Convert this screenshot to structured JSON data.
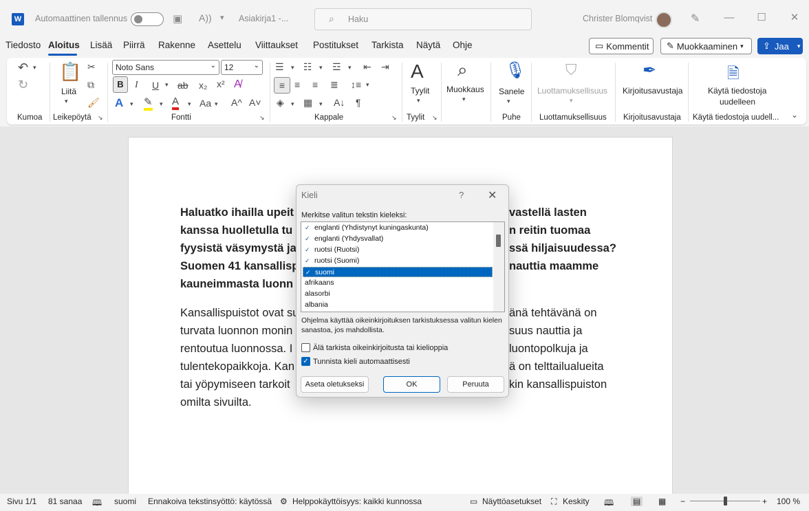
{
  "titlebar": {
    "app_icon": "W",
    "autosave_label": "Automaattinen tallennus",
    "doc_name": "Asiakirja1 -...",
    "search_placeholder": "Haku",
    "user_name": "Christer Blomqvist"
  },
  "menu": {
    "tabs": [
      "Tiedosto",
      "Aloitus",
      "Lisää",
      "Piirrä",
      "Rakenne",
      "Asettelu",
      "Viittaukset",
      "Postitukset",
      "Tarkista",
      "Näytä",
      "Ohje"
    ],
    "comments_label": "Kommentit",
    "editing_label": "Muokkaaminen",
    "share_label": "Jaa"
  },
  "ribbon": {
    "groups": {
      "undo": "Kumoa",
      "clipboard": "Leikepöytä",
      "font": "Fontti",
      "paragraph": "Kappale",
      "styles": "Tyylit",
      "voice": "Puhe",
      "sensitivity": "Luottamuksellisuus",
      "editor": "Kirjoitusavustaja",
      "reuse": "Käytä tiedostoja uudell..."
    },
    "paste_label": "Liitä",
    "font_name": "Noto Sans",
    "font_size": "12",
    "styles_label": "Tyylit",
    "find_label": "Muokkaus",
    "dictate_label": "Sanele",
    "sensitivity_label": "Luottamuksellisuus",
    "editor_label": "Kirjoitusavustaja",
    "reuse_label_1": "Käytä tiedostoja",
    "reuse_label_2": "uudelleen",
    "format_labels": {
      "bold": "B",
      "italic": "I",
      "underline": "U",
      "strike": "ab",
      "subscript": "x₂",
      "superscript": "x²",
      "case": "Aa",
      "grow": "A^",
      "shrink": "A˅",
      "pilcrow": "¶"
    }
  },
  "document": {
    "p1_lines": [
      "Haluatko ihailla upeit",
      "kanssa huolletulla tu",
      "fyysistä väsymystä ja",
      "Suomen 41 kansallisp",
      "kauneimmasta luonn"
    ],
    "p1_right": [
      "vastellä lasten",
      "n reitin tuomaa",
      "ssä hiljaisuudessa?",
      "nauttia maamme",
      ""
    ],
    "p2_lines": [
      "Kansallispuistot ovat su",
      "turvata luonnon monin",
      "rentoutua luonnossa. I",
      "tulentekopaikkoja. Kan",
      "tai yöpymiseen tarkoit",
      "omilta sivuilta."
    ],
    "p2_right": [
      "änä tehtävänä on",
      "suus nauttia ja",
      "luontopolkuja ja",
      "ä on telttailualueita",
      "kin kansallispuiston",
      ""
    ]
  },
  "dialog": {
    "title": "Kieli",
    "help": "?",
    "close": "✕",
    "prompt": "Merkitse valitun tekstin kieleksi:",
    "languages": [
      {
        "name": "englanti (Yhdistynyt kuningaskunta)",
        "checked": true,
        "selected": false
      },
      {
        "name": "englanti (Yhdysvallat)",
        "checked": true,
        "selected": false
      },
      {
        "name": "ruotsi (Ruotsi)",
        "checked": true,
        "selected": false
      },
      {
        "name": "ruotsi (Suomi)",
        "checked": true,
        "selected": false
      },
      {
        "name": "suomi",
        "checked": true,
        "selected": true
      },
      {
        "name": "afrikaans",
        "checked": false,
        "selected": false
      },
      {
        "name": "alasorbi",
        "checked": false,
        "selected": false
      },
      {
        "name": "albania",
        "checked": false,
        "selected": false
      }
    ],
    "info": "Ohjelma käyttää oikeinkirjoituksen tarkistuksessa valitun kielen sanastoa, jos mahdollista.",
    "no_proof_label": "Älä tarkista oikeinkirjoitusta tai kielioppia",
    "no_proof_checked": false,
    "detect_label": "Tunnista kieli automaattisesti",
    "detect_checked": true,
    "default_button": "Aseta oletukseksi",
    "ok_button": "OK",
    "cancel_button": "Peruuta"
  },
  "status": {
    "page": "Sivu 1/1",
    "words": "81 sanaa",
    "language": "suomi",
    "predictive": "Ennakoiva tekstinsyöttö: käytössä",
    "accessibility": "Helppokäyttöisyys: kaikki kunnossa",
    "display_settings": "Näyttöasetukset",
    "focus": "Keskity",
    "zoom_minus": "−",
    "zoom_plus": "+",
    "zoom": "100 %",
    "zoom_level": 0.5
  },
  "colors": {
    "accent": "#185abd",
    "selection": "#0067c0"
  }
}
